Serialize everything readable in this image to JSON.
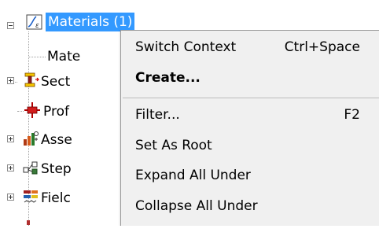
{
  "tree": {
    "items": [
      {
        "label": "Materials (1)",
        "icon": "materials-icon",
        "selected": true,
        "toggle": "minus"
      },
      {
        "label": "Mate",
        "icon": "",
        "selected": false,
        "toggle": ""
      },
      {
        "label": "Sect",
        "icon": "sections-icon",
        "selected": false,
        "toggle": "plus"
      },
      {
        "label": "Prof",
        "icon": "profiles-icon",
        "selected": false,
        "toggle": ""
      },
      {
        "label": "Asse",
        "icon": "assembly-icon",
        "selected": false,
        "toggle": "plus"
      },
      {
        "label": "Step",
        "icon": "steps-icon",
        "selected": false,
        "toggle": "plus"
      },
      {
        "label": "Fielc",
        "icon": "field-output-icon",
        "selected": false,
        "toggle": "plus"
      }
    ]
  },
  "context_menu": {
    "items": [
      {
        "label": "Switch Context",
        "shortcut": "Ctrl+Space",
        "bold": false
      },
      {
        "label": "Create...",
        "shortcut": "",
        "bold": true
      },
      {
        "label": "Filter...",
        "shortcut": "F2",
        "bold": false
      },
      {
        "label": "Set As Root",
        "shortcut": "",
        "bold": false
      },
      {
        "label": "Expand All Under",
        "shortcut": "",
        "bold": false
      },
      {
        "label": "Collapse All Under",
        "shortcut": "",
        "bold": false
      }
    ]
  },
  "colors": {
    "selection": "#3399ff",
    "menu_background": "#f0f0f0"
  }
}
